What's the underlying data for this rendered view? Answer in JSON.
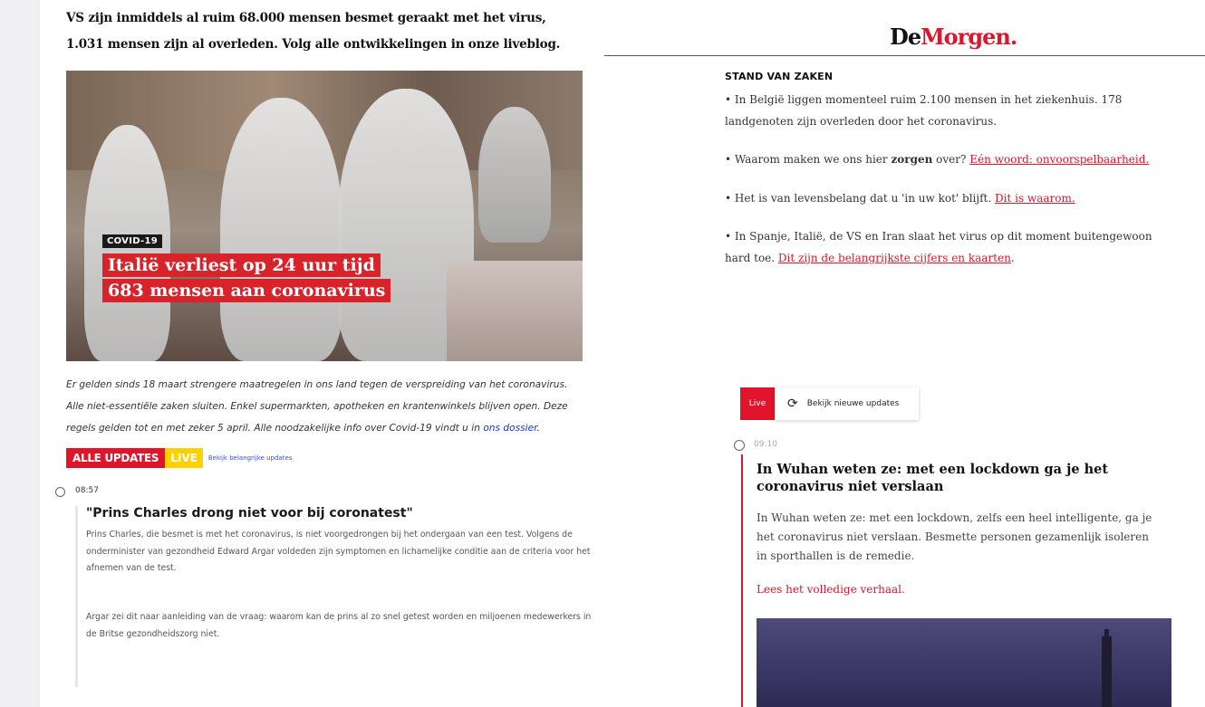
{
  "left": {
    "intro_lines": [
      "VS zijn inmiddels al ruim 68.000 mensen besmet geraakt met het virus,",
      "1.031 mensen zijn al overleden. Volg alle ontwikkelingen in onze liveblog."
    ],
    "hero": {
      "tag": "COVID-19",
      "headline_line1": "Italië verliest op 24 uur tijd",
      "headline_line2": "683 mensen aan coronavirus"
    },
    "description": "Er gelden sinds 18 maart strengere maatregelen in ons land tegen de verspreiding van het coronavirus. Alle niet-essentiële zaken sluiten. Enkel supermarkten, apotheken en krantenwinkels blijven open. Deze regels gelden tot en met zeker 5 april. Alle noodzakelijke info over Covid-19 vindt u in",
    "description_link": "ons dossier",
    "updates_bar": {
      "alle_label": "ALLE UPDATES",
      "live_label": "LIVE",
      "link_label": "Bekijk belangrijke updates"
    },
    "entry": {
      "time": "08:57",
      "title": "\"Prins Charles drong niet voor bij coronatest\"",
      "p1": "Prins Charles, die besmet is met het coronavirus, is niet voorgedrongen bij het ondergaan van een test. Volgens de onderminister van gezondheid Edward Argar voldeden zijn symptomen en lichamelijke conditie aan de criteria voor het afnemen van de test.",
      "p2": "Argar zei dit naar aanleiding van de vraag: waarom kan de prins al zo snel getest worden en miljoenen medewerkers in de Britse gezondheidszorg niet."
    }
  },
  "right": {
    "logo_part1": "De",
    "logo_part2": "Morgen.",
    "section_title": "STAND VAN ZAKEN",
    "bullets": [
      {
        "text": "• In België liggen momenteel ruim 2.100 mensen in het ziekenhuis. 178 landgenoten zijn overleden door het coronavirus.",
        "link": ""
      },
      {
        "text": "• Waarom maken we ons hier ",
        "bold": "zorgen",
        "text2": " over? ",
        "link": "Eén woord: onvoorspelbaarheid."
      },
      {
        "text": "• Het is van levensbelang dat u 'in uw kot' blijft. ",
        "link": "Dit is waarom."
      },
      {
        "text": "• In Spanje, Italië, de VS en Iran slaat het virus op dit moment buitengewoon hard toe. ",
        "link": "Dit zijn de belangrijkste cijfers en kaarten",
        "suffix": "."
      }
    ],
    "live_label": "Live",
    "new_updates_label": "Bekijk nieuwe updates",
    "post": {
      "time": "09:10",
      "title": "In Wuhan weten ze: met een lockdown ga je het coronavirus niet verslaan",
      "body": "In Wuhan weten ze: met een lockdown, zelfs een heel intelligente, ga je het coronavirus niet verslaan. Besmette personen gezamenlijk isoleren in sporthallen is de remedie.",
      "more_link": "Lees het volledige verhaal."
    }
  }
}
